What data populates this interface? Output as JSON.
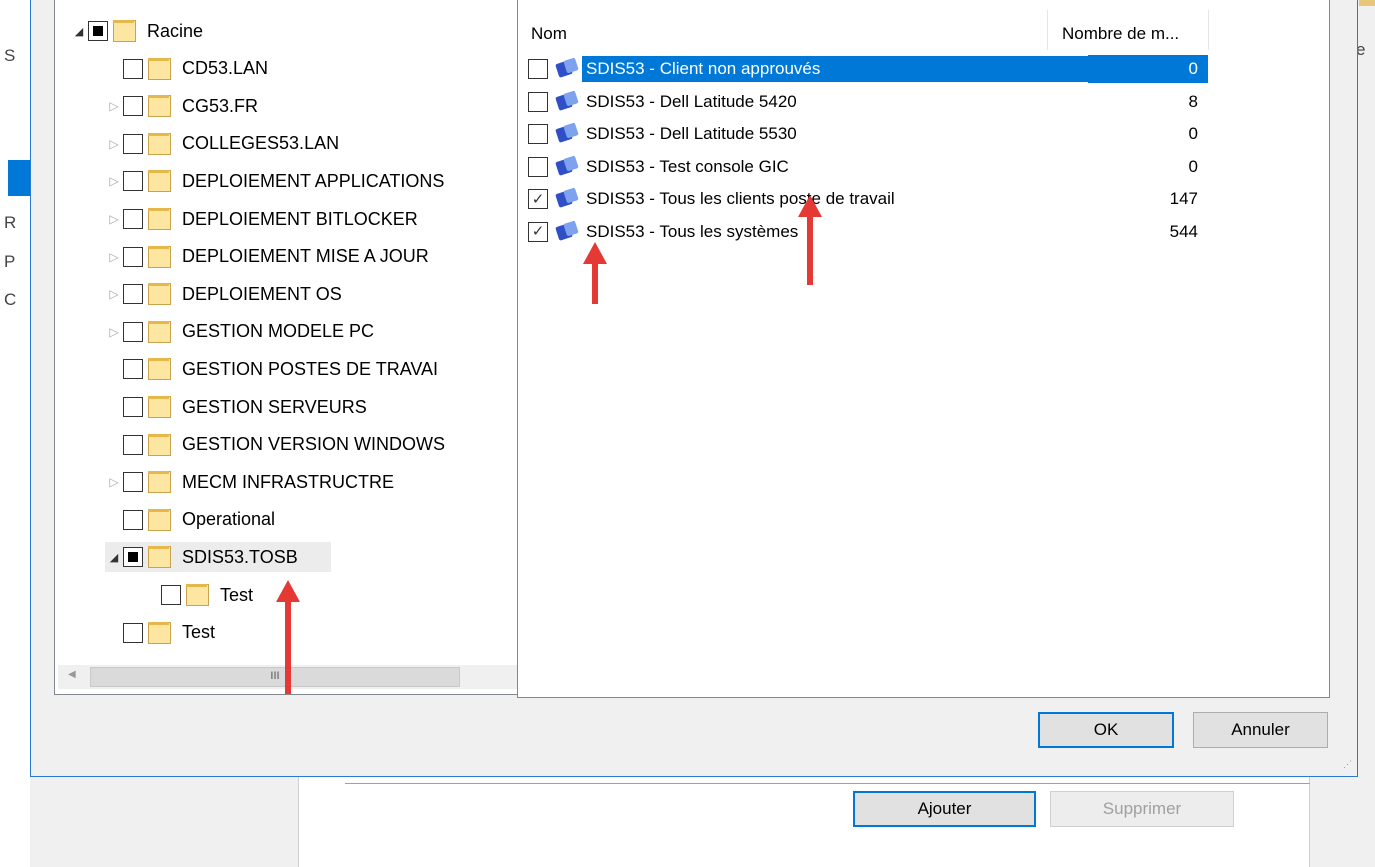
{
  "background": {
    "left_letters": [
      "S",
      "R",
      "P",
      "C"
    ],
    "right_fragment": "e",
    "buttons": {
      "add": "Ajouter",
      "remove": "Supprimer"
    }
  },
  "tree": {
    "items": [
      {
        "label": "Racine",
        "check": "partial",
        "expander": "expanded",
        "level": 0
      },
      {
        "label": "CD53.LAN",
        "check": "none",
        "expander": "none",
        "level": 1
      },
      {
        "label": "CG53.FR",
        "check": "none",
        "expander": "collapsed",
        "level": 1
      },
      {
        "label": "COLLEGES53.LAN",
        "check": "none",
        "expander": "collapsed",
        "level": 1
      },
      {
        "label": "DEPLOIEMENT APPLICATIONS",
        "check": "none",
        "expander": "collapsed",
        "level": 1
      },
      {
        "label": "DEPLOIEMENT BITLOCKER",
        "check": "none",
        "expander": "collapsed",
        "level": 1
      },
      {
        "label": "DEPLOIEMENT MISE A JOUR",
        "check": "none",
        "expander": "collapsed",
        "level": 1
      },
      {
        "label": "DEPLOIEMENT OS",
        "check": "none",
        "expander": "collapsed",
        "level": 1
      },
      {
        "label": "GESTION MODELE PC",
        "check": "none",
        "expander": "collapsed",
        "level": 1
      },
      {
        "label": "GESTION POSTES DE TRAVAI",
        "check": "none",
        "expander": "none",
        "level": 1
      },
      {
        "label": "GESTION SERVEURS",
        "check": "none",
        "expander": "none",
        "level": 1
      },
      {
        "label": "GESTION VERSION WINDOWS",
        "check": "none",
        "expander": "none",
        "level": 1
      },
      {
        "label": "MECM INFRASTRUCTRE",
        "check": "none",
        "expander": "collapsed",
        "level": 1
      },
      {
        "label": "Operational",
        "check": "none",
        "expander": "none",
        "level": 1
      },
      {
        "label": "SDIS53.TOSB",
        "check": "partial",
        "expander": "expanded",
        "level": 1,
        "selected": true
      },
      {
        "label": "Test",
        "check": "none",
        "expander": "none",
        "level": 2
      },
      {
        "label": "Test",
        "check": "none",
        "expander": "none",
        "level": 1
      }
    ],
    "scroll_grip": "III"
  },
  "list": {
    "columns": {
      "name": "Nom",
      "count": "Nombre de m..."
    },
    "rows": [
      {
        "name": "SDIS53 - Client non approuvés",
        "count": "0",
        "checked": false,
        "selected": true
      },
      {
        "name": "SDIS53 - Dell Latitude 5420",
        "count": "8",
        "checked": false
      },
      {
        "name": "SDIS53 - Dell Latitude 5530",
        "count": "0",
        "checked": false
      },
      {
        "name": "SDIS53 - Test console GIC",
        "count": "0",
        "checked": false
      },
      {
        "name": "SDIS53 - Tous les clients poste de travail",
        "count": "147",
        "checked": true
      },
      {
        "name": "SDIS53 - Tous les systèmes",
        "count": "544",
        "checked": true
      }
    ]
  },
  "buttons": {
    "ok": "OK",
    "cancel": "Annuler"
  },
  "colors": {
    "selection": "#0078d7",
    "annotation_arrow": "#e53935"
  }
}
